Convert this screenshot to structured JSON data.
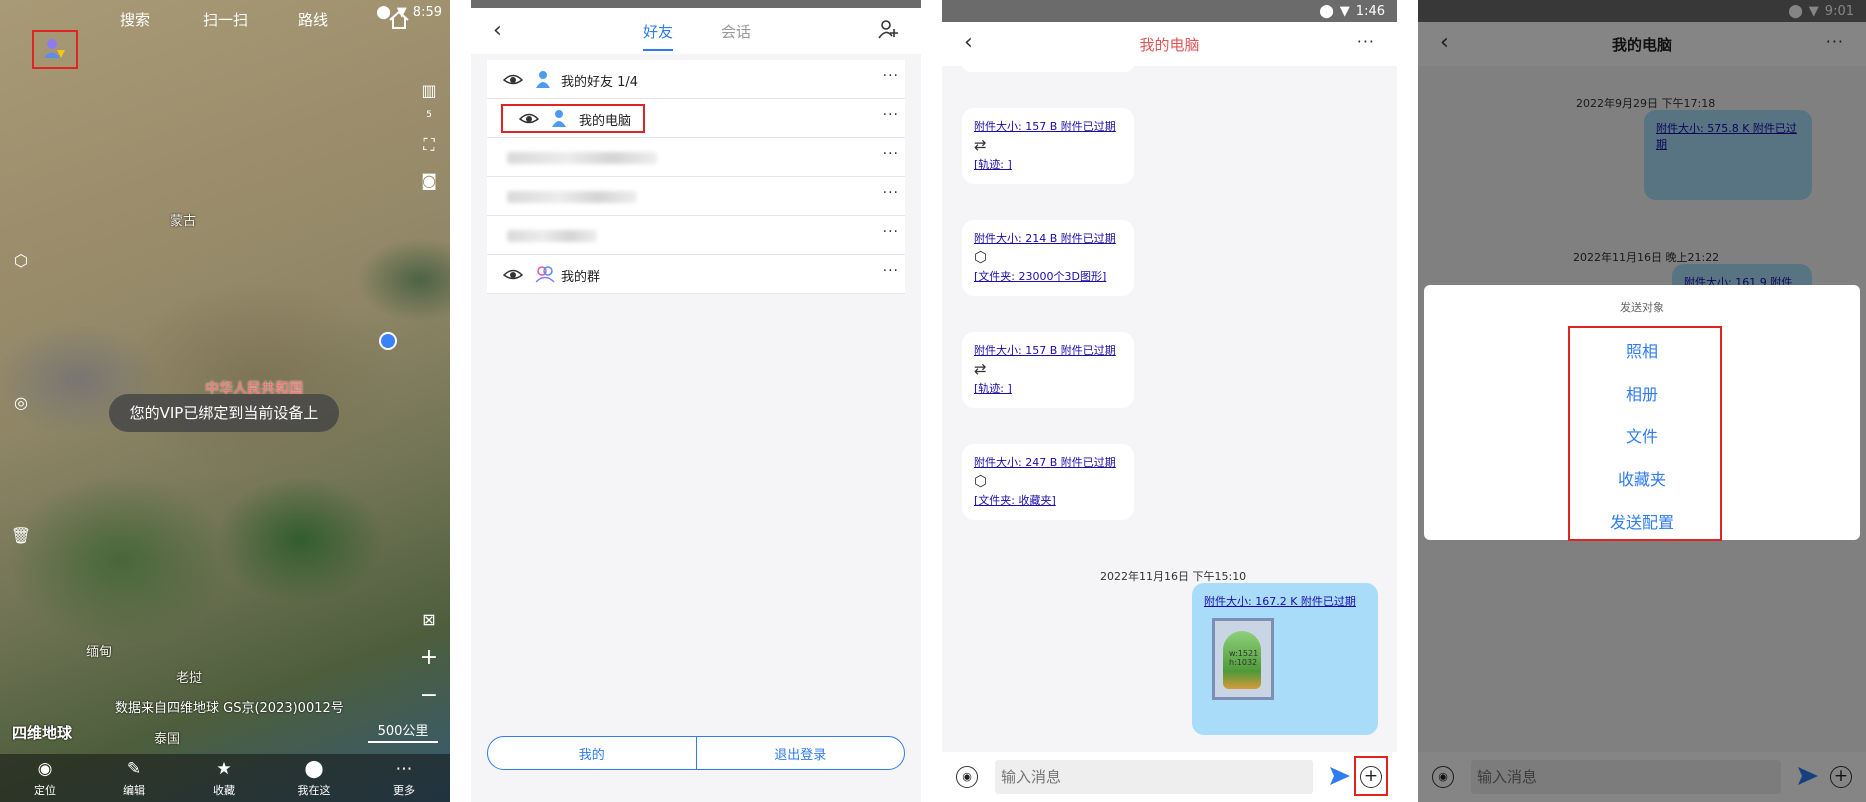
{
  "panel_map": {
    "status_time": "8:59",
    "topbar": {
      "search": "搜索",
      "scan": "扫一扫",
      "route": "路线"
    },
    "places": {
      "mongolia": "蒙古",
      "china": "中华人民共和国",
      "myanmar": "缅甸",
      "laos": "老挝",
      "thailand": "泰国"
    },
    "toast": "您的VIP已绑定到当前设备上",
    "attribution": "数据来自四维地球 GS京(2023)0012号",
    "logo": "四维地球",
    "scale": "500公里",
    "layer_count": "5",
    "bottom_nav": [
      {
        "label": "定位",
        "icon": "target-icon"
      },
      {
        "label": "编辑",
        "icon": "edit-icon"
      },
      {
        "label": "收藏",
        "icon": "star-icon"
      },
      {
        "label": "我在这",
        "icon": "pin-icon"
      },
      {
        "label": "更多",
        "icon": "more-icon"
      }
    ]
  },
  "panel_friends": {
    "tabs": {
      "friends": "好友",
      "sessions": "会话"
    },
    "groups": {
      "my_friends": "我的好友 1/4",
      "my_computer": "我的电脑",
      "my_groups": "我的群"
    },
    "more": "···",
    "buttons": {
      "me": "我的",
      "logout": "退出登录"
    }
  },
  "panel_chat": {
    "status_time": "1:46",
    "title": "我的电脑",
    "more": "···",
    "messages": [
      {
        "link": "附件大小: 157 B 附件已过期",
        "symbol": "⇄",
        "tag": "[轨迹: ]"
      },
      {
        "link": "附件大小: 214 B 附件已过期",
        "symbol": "⬡",
        "tag": "[文件夹: 23000个3D图形]"
      },
      {
        "link": "附件大小: 157 B 附件已过期",
        "symbol": "⇄",
        "tag": "[轨迹: ]"
      },
      {
        "link": "附件大小: 247 B 附件已过期",
        "symbol": "⬡",
        "tag": "[文件夹: 收藏夹]"
      }
    ],
    "date": "2022年11月16日 下午15:10",
    "mine_link": "附件大小: 167.2 K 附件已过期",
    "thumb_text": "w:1521\nh:1032",
    "input_placeholder": "输入消息"
  },
  "panel_sheet": {
    "status_time": "9:01",
    "title": "我的电脑",
    "date1": "2022年9月29日 下午17:18",
    "link1": "附件大小: 575.8 K 附件已过期",
    "date2": "2022年11月16日 晚上21:22",
    "link2": "附件大小: 161.9 附件已过期",
    "sheet_title": "发送对象",
    "options": [
      "照相",
      "相册",
      "文件",
      "收藏夹",
      "发送配置"
    ],
    "input_placeholder": "输入消息"
  },
  "colors": {
    "accent": "#2f7bf0",
    "highlight": "#e02424",
    "bubble_mine": "#a9dcf8",
    "title_red": "#e05555"
  }
}
